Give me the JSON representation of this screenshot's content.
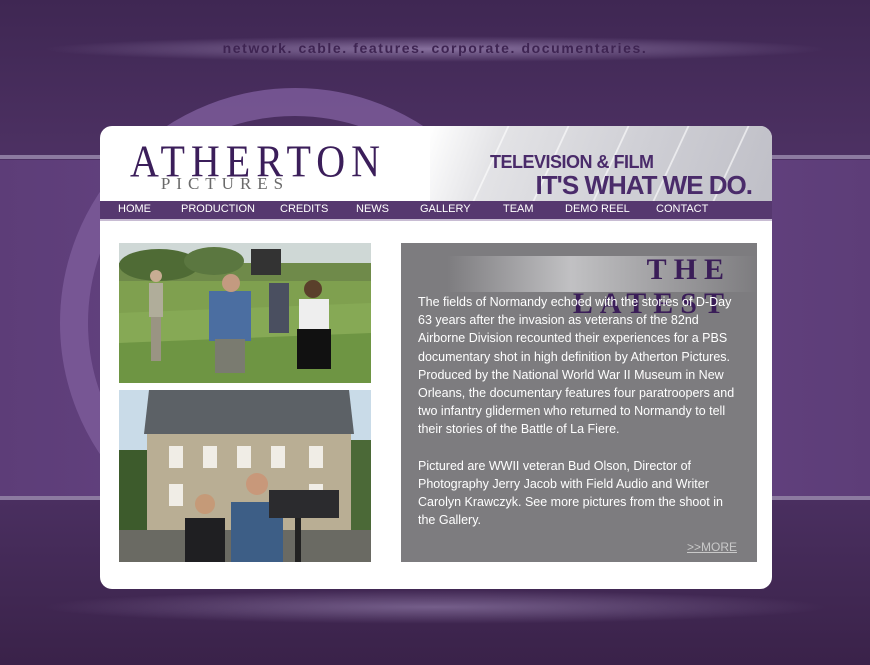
{
  "tagline": "network. cable. features. corporate. documentaries.",
  "logo": {
    "name": "ATHERTON",
    "sub": "PICTURES"
  },
  "header": {
    "line1": "TELEVISION & FILM",
    "line2": "IT'S WHAT WE DO."
  },
  "nav": [
    "HOME",
    "PRODUCTION",
    "CREDITS",
    "NEWS",
    "GALLERY",
    "TEAM",
    "DEMO REEL",
    "CONTACT"
  ],
  "latest": {
    "title": "THE LATEST",
    "paragraph1": "The fields of Normandy echoed with the stories of D-Day 63 years after the invasion as veterans of the 82nd Airborne Division recounted their experiences for a PBS documentary shot in high definition by Atherton Pictures. Produced by the National World War II Museum in New Orleans, the documentary features four paratroopers and two infantry glidermen who returned to Normandy to tell their stories of the Battle of La Fiere.",
    "paragraph2": "Pictured are WWII veteran Bud Olson, Director of Photography Jerry Jacob with Field Audio and Writer Carolyn Krawczyk. See more pictures from the shoot in the Gallery.",
    "more": ">>MORE"
  },
  "colors": {
    "purple": "#56386f",
    "panel": "#7d7c7f",
    "accent": "#3a1d58"
  }
}
